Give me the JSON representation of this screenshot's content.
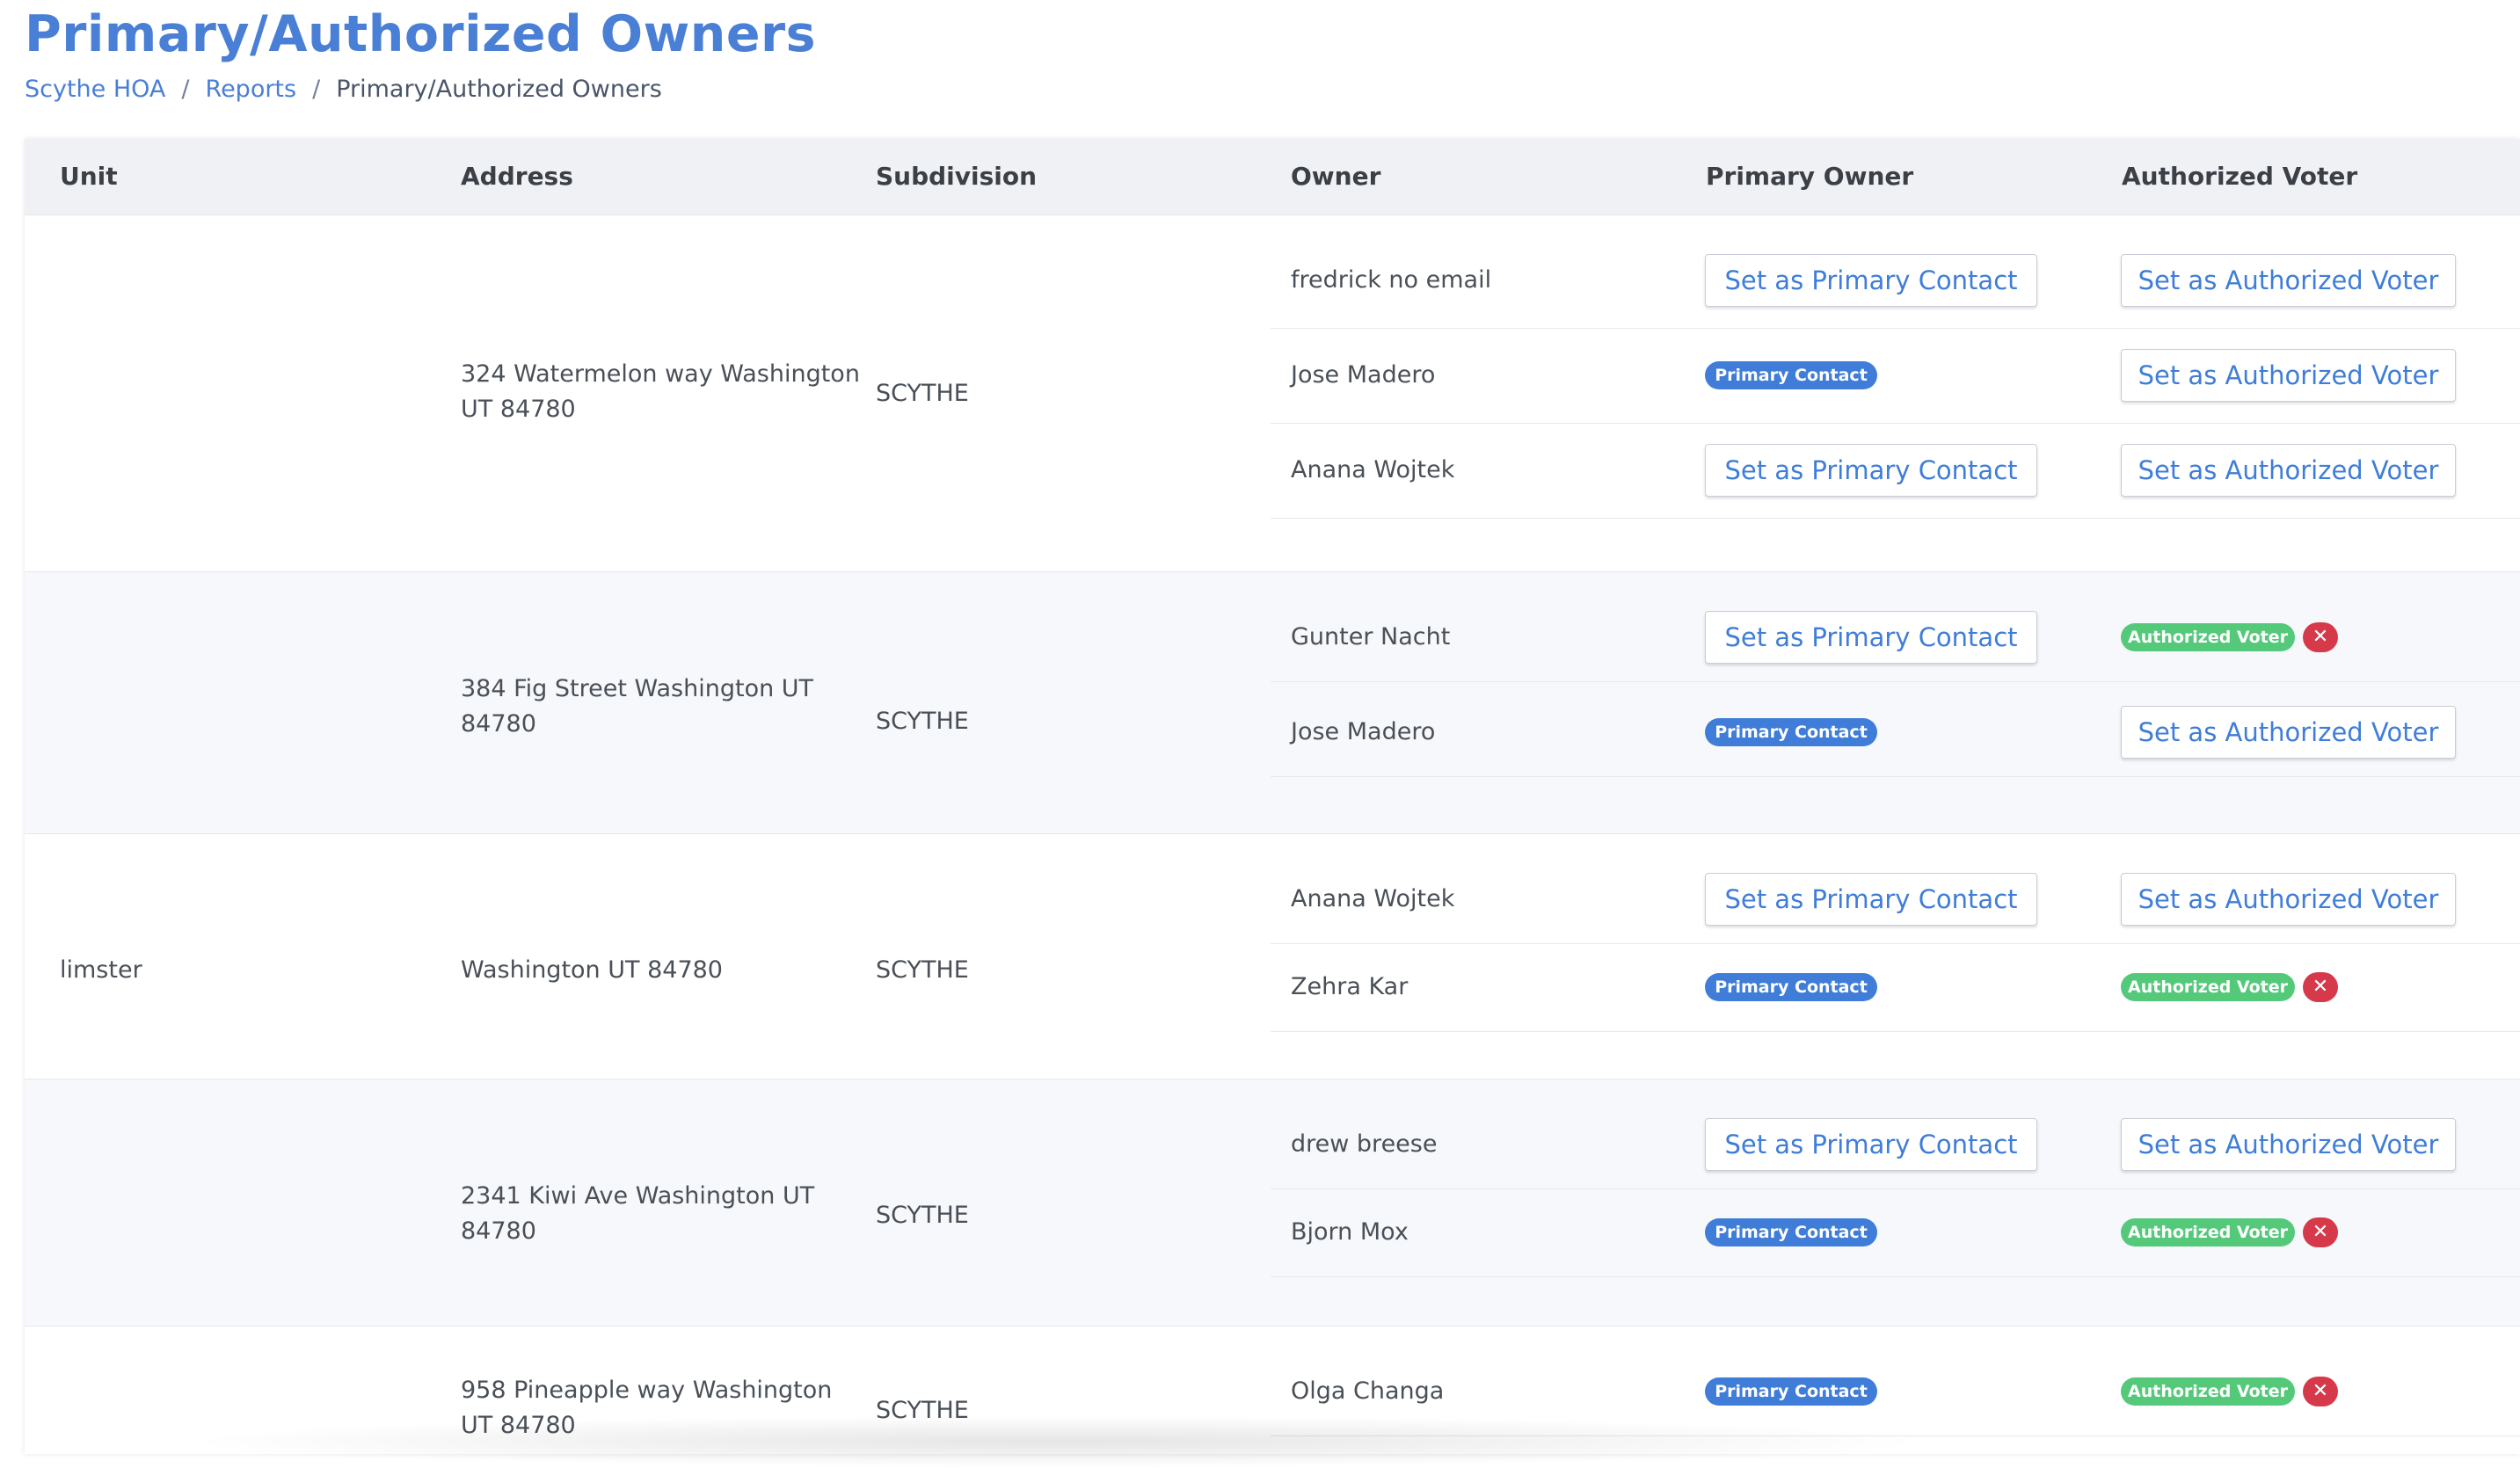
{
  "page": {
    "title": "Primary/Authorized Owners"
  },
  "breadcrumb": {
    "items": [
      {
        "label": "Scythe HOA",
        "link": true
      },
      {
        "label": "Reports",
        "link": true
      },
      {
        "label": "Primary/Authorized Owners",
        "link": false
      }
    ],
    "separator": "/"
  },
  "table": {
    "columns": [
      "Unit",
      "Address",
      "Subdivision",
      "Owner",
      "Primary Owner",
      "Authorized Voter"
    ],
    "labels": {
      "set_primary": "Set as Primary Contact",
      "set_voter": "Set as Authorized Voter",
      "primary_badge": "Primary Contact",
      "voter_badge": "Authorized Voter",
      "remove_glyph": "✕"
    },
    "rows": [
      {
        "unit": "",
        "address_line1": "324 Watermelon way Washington",
        "address_line2": "UT 84780",
        "subdivision": "SCYTHE",
        "owners": [
          {
            "name": "fredrick no email",
            "primary": false,
            "voter": false
          },
          {
            "name": "Jose Madero",
            "primary": true,
            "voter": false
          },
          {
            "name": "Anana Wojtek",
            "primary": false,
            "voter": false
          }
        ]
      },
      {
        "unit": "",
        "address_line1": "384 Fig Street Washington UT",
        "address_line2": "84780",
        "subdivision": "SCYTHE",
        "owners": [
          {
            "name": "Gunter Nacht",
            "primary": false,
            "voter": true
          },
          {
            "name": "Jose Madero",
            "primary": true,
            "voter": false
          }
        ]
      },
      {
        "unit": "limster",
        "address_line1": "Washington UT 84780",
        "address_line2": "",
        "subdivision": "SCYTHE",
        "owners": [
          {
            "name": "Anana Wojtek",
            "primary": false,
            "voter": false
          },
          {
            "name": "Zehra Kar",
            "primary": true,
            "voter": true
          }
        ]
      },
      {
        "unit": "",
        "address_line1": "2341 Kiwi Ave Washington UT",
        "address_line2": "84780",
        "subdivision": "SCYTHE",
        "owners": [
          {
            "name": "drew breese",
            "primary": false,
            "voter": false
          },
          {
            "name": "Bjorn Mox",
            "primary": true,
            "voter": true
          }
        ]
      },
      {
        "unit": "",
        "address_line1": "958 Pineapple way Washington",
        "address_line2": "UT 84780",
        "subdivision": "SCYTHE",
        "owners": [
          {
            "name": "Olga Changa",
            "primary": true,
            "voter": true
          }
        ]
      }
    ]
  },
  "colors": {
    "accent": "#4a7fd6",
    "primary_badge": "#3f7dd8",
    "voter_badge": "#55c97a",
    "remove": "#d63a4a"
  }
}
